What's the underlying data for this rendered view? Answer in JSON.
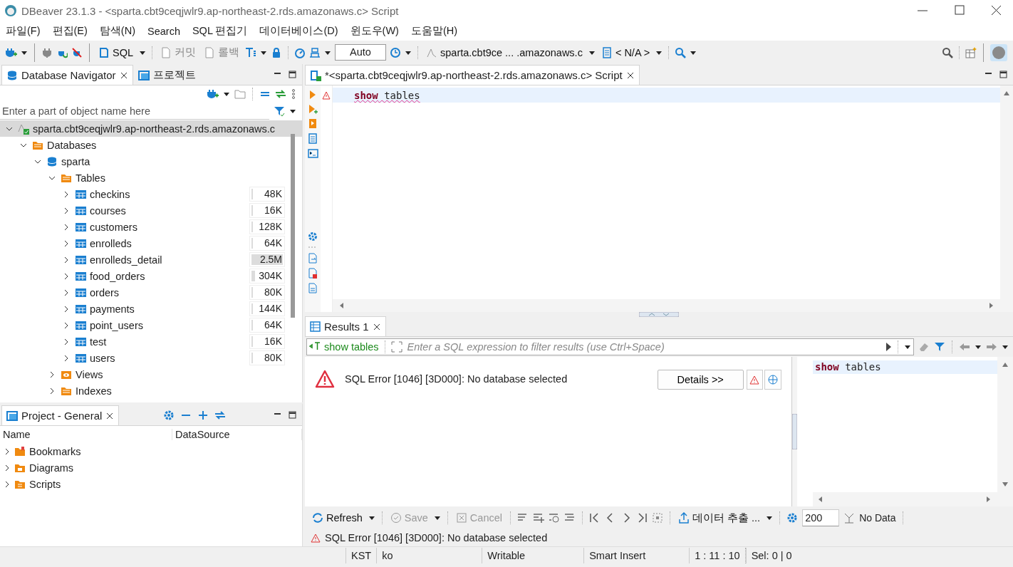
{
  "window": {
    "title": "DBeaver 23.1.3 - <sparta.cbt9ceqjwlr9.ap-northeast-2.rds.amazonaws.c> Script"
  },
  "menu": [
    "파일(F)",
    "편집(E)",
    "탐색(N)",
    "Search",
    "SQL 편집기",
    "데이터베이스(D)",
    "윈도우(W)",
    "도움말(H)"
  ],
  "toolbar": {
    "sql_button": "SQL",
    "commit": {
      "label": "커밋",
      "disabled": true
    },
    "rollback": {
      "label": "롤백",
      "disabled": true
    },
    "transaction_mode": "Auto",
    "datasource": "sparta.cbt9ce ... .amazonaws.c",
    "schema": "< N/A >"
  },
  "navigator": {
    "tabs": [
      {
        "label": "Database Navigator",
        "selected": true
      },
      {
        "label": "프로젝트",
        "selected": false
      }
    ],
    "filter": {
      "placeholder": "Enter a part of object name here"
    },
    "tree": [
      {
        "label": "sparta.cbt9ceqjwlr9.ap-northeast-2.rds.amazonaws.c",
        "kind": "connection",
        "expanded": true,
        "selected": true,
        "children": [
          {
            "label": "Databases",
            "kind": "folder",
            "expanded": true,
            "selected": false,
            "children": [
              {
                "label": "sparta",
                "kind": "database",
                "expanded": true,
                "selected": false,
                "children": [
                  {
                    "label": "Tables",
                    "kind": "folder",
                    "expanded": true,
                    "selected": false,
                    "children": [
                      {
                        "label": "checkins",
                        "kind": "table",
                        "expanded": false,
                        "selected": false,
                        "size": "48K",
                        "level": 0.02
                      },
                      {
                        "label": "courses",
                        "kind": "table",
                        "expanded": false,
                        "selected": false,
                        "size": "16K",
                        "level": 0.01
                      },
                      {
                        "label": "customers",
                        "kind": "table",
                        "expanded": false,
                        "selected": false,
                        "size": "128K",
                        "level": 0.04
                      },
                      {
                        "label": "enrolleds",
                        "kind": "table",
                        "expanded": false,
                        "selected": false,
                        "size": "64K",
                        "level": 0.02
                      },
                      {
                        "label": "enrolleds_detail",
                        "kind": "table",
                        "expanded": false,
                        "selected": false,
                        "size": "2.5M",
                        "level": 1
                      },
                      {
                        "label": "food_orders",
                        "kind": "table",
                        "expanded": false,
                        "selected": false,
                        "size": "304K",
                        "level": 0.12
                      },
                      {
                        "label": "orders",
                        "kind": "table",
                        "expanded": false,
                        "selected": false,
                        "size": "80K",
                        "level": 0.03
                      },
                      {
                        "label": "payments",
                        "kind": "table",
                        "expanded": false,
                        "selected": false,
                        "size": "144K",
                        "level": 0.05
                      },
                      {
                        "label": "point_users",
                        "kind": "table",
                        "expanded": false,
                        "selected": false,
                        "size": "64K",
                        "level": 0.02
                      },
                      {
                        "label": "test",
                        "kind": "table",
                        "expanded": false,
                        "selected": false,
                        "size": "16K",
                        "level": 0.01
                      },
                      {
                        "label": "users",
                        "kind": "table",
                        "expanded": false,
                        "selected": false,
                        "size": "80K",
                        "level": 0.03
                      }
                    ]
                  },
                  {
                    "label": "Views",
                    "kind": "views",
                    "expanded": false,
                    "selected": false
                  },
                  {
                    "label": "Indexes",
                    "kind": "folder",
                    "expanded": false,
                    "selected": false
                  }
                ]
              }
            ]
          }
        ]
      }
    ]
  },
  "project": {
    "title": "Project - General",
    "columns": [
      "Name",
      "DataSource"
    ],
    "items": [
      "Bookmarks",
      "Diagrams",
      "Scripts"
    ]
  },
  "editor": {
    "tab": "*<sparta.cbt9ceqjwlr9.ap-northeast-2.rds.amazonaws.c> Script",
    "lines": [
      {
        "tokens": [
          {
            "text": "show",
            "kind": "keyword"
          },
          {
            "text": " tables",
            "kind": "plain"
          }
        ],
        "error": true
      }
    ]
  },
  "results": {
    "tab": "Results 1",
    "query": "show tables",
    "filter": {
      "placeholder": "Enter a SQL expression to filter results (use Ctrl+Space)"
    },
    "error": "SQL Error [1046] [3D000]: No database selected",
    "details_button": "Details >>",
    "side_code": [
      {
        "text": "show",
        "kind": "keyword"
      },
      {
        "text": " tables",
        "kind": "plain"
      }
    ],
    "buttons": [
      {
        "label": "Refresh",
        "disabled": false
      },
      {
        "label": "Save",
        "disabled": true
      },
      {
        "label": "Cancel",
        "disabled": true
      }
    ],
    "export": "데이터 추출 ...",
    "fetch_size": "200",
    "row_count": "No Data",
    "message": "SQL Error [1046] [3D000]: No database selected"
  },
  "status_bar": [
    "KST",
    "ko",
    "Writable",
    "Smart Insert",
    "1 : 11 : 10",
    "Sel: 0 | 0"
  ]
}
